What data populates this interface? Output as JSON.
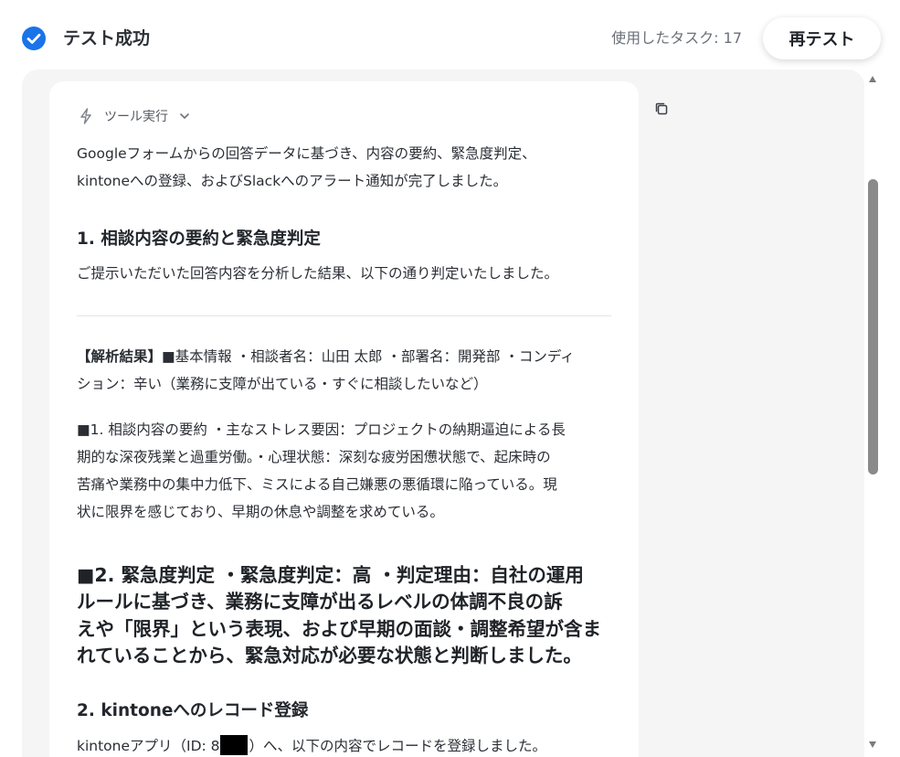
{
  "header": {
    "status_title": "テスト成功",
    "task_count": "使用したタスク: 17",
    "retest_label": "再テスト"
  },
  "card": {
    "tool_label": "ツール実行",
    "intro_line1": "Googleフォームからの回答データに基づき、内容の要約、緊急度判定、",
    "intro_line2": "kintoneへの登録、およびSlackへのアラート通知が完了しました。",
    "section1_heading": "1. 相談内容の要約と緊急度判定",
    "section1_text": "ご提示いただいた回答内容を分析した結果、以下の通り判定いたしました。",
    "analysis_label": "【解析結果】",
    "analysis_line1_rest": "■基本情報 ・相談者名：山田 太郎 ・部署名：開発部 ・コンディ",
    "analysis_line2": "ション：辛い（業務に支障が出ている・すぐに相談したいなど）",
    "summary_line1": "■1. 相談内容の要約 ・主なストレス要因：プロジェクトの納期逼迫による長",
    "summary_line2": "期的な深夜残業と過重労働。・心理状態：深刻な疲労困憊状態で、起床時の",
    "summary_line3": "苦痛や業務中の集中力低下、ミスによる自己嫌悪の悪循環に陥っている。現",
    "summary_line4": "状に限界を感じており、早期の休息や調整を求めている。",
    "urgency_line1": "■2. 緊急度判定 ・緊急度判定：高 ・判定理由：自社の運用",
    "urgency_line2": "ルールに基づき、業務に支障が出るレベルの体調不良の訴",
    "urgency_line3": "えや「限界」という表現、および早期の面談・調整希望が含ま",
    "urgency_line4": "れていることから、緊急対応が必要な状態と判断しました。",
    "section2_heading": "2. kintoneへのレコード登録",
    "section2_text_before": "kintoneアプリ（ID: 8",
    "section2_text_after": "）へ、以下の内容でレコードを登録しました。"
  },
  "colors": {
    "accent_blue": "#1a73e8",
    "panel_bg": "#f5f5f6",
    "scroll_thumb": "#8a8a8a"
  },
  "icons": {
    "status": "check-circle-icon",
    "tool": "bolt-icon",
    "expand": "chevron-down-icon",
    "copy": "copy-icon"
  }
}
